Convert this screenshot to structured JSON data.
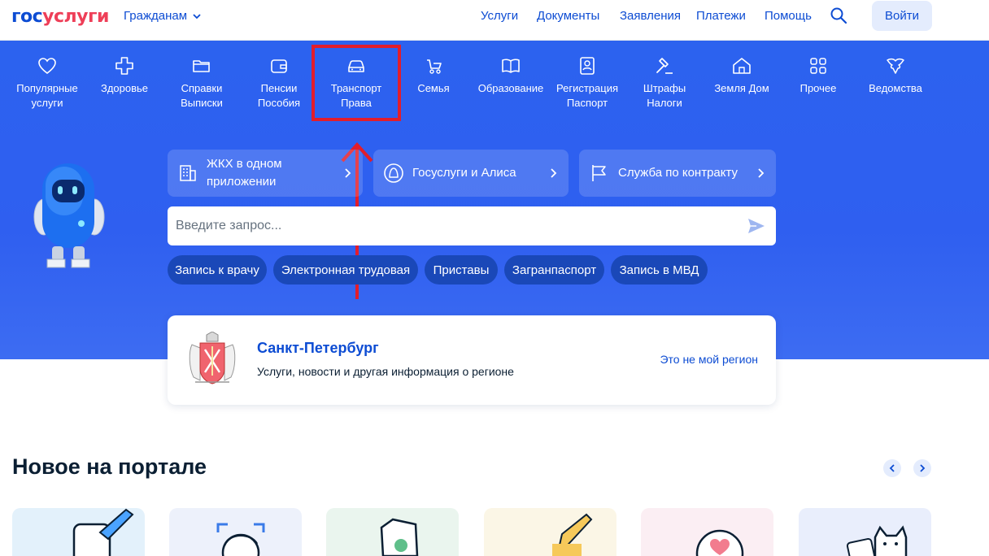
{
  "header": {
    "logo_part1": "гос",
    "logo_part2": "услуги",
    "audience_label": "Гражданам",
    "nav": [
      "Услуги",
      "Документы",
      "Заявления",
      "Платежи",
      "Помощь"
    ],
    "login_label": "Войти"
  },
  "categories": [
    {
      "label": "Популярные\nуслуги",
      "icon": "heart-icon"
    },
    {
      "label": "Здоровье",
      "icon": "medical-cross-icon"
    },
    {
      "label": "Справки\nВыписки",
      "icon": "folder-icon"
    },
    {
      "label": "Пенсии\nПособия",
      "icon": "wallet-icon"
    },
    {
      "label": "Транспорт\nПрава",
      "icon": "car-icon"
    },
    {
      "label": "Семья",
      "icon": "stroller-icon"
    },
    {
      "label": "Образование",
      "icon": "book-icon"
    },
    {
      "label": "Регистрация\nПаспорт",
      "icon": "id-card-icon"
    },
    {
      "label": "Штрафы\nНалоги",
      "icon": "gavel-icon"
    },
    {
      "label": "Земля Дом",
      "icon": "house-icon"
    },
    {
      "label": "Прочее",
      "icon": "grid-icon"
    },
    {
      "label": "Ведомства",
      "icon": "eagle-icon"
    }
  ],
  "promos": [
    {
      "text": "ЖКХ в одном\nприложении",
      "icon": "building-icon"
    },
    {
      "text": "Госуслуги и Алиса",
      "icon": "alice-icon"
    },
    {
      "text": "Служба по контракту",
      "icon": "flag-icon"
    }
  ],
  "search": {
    "placeholder": "Введите запрос..."
  },
  "chips": [
    "Запись к врачу",
    "Электронная трудовая",
    "Приставы",
    "Загранпаспорт",
    "Запись в МВД"
  ],
  "region": {
    "title": "Санкт-Петербург",
    "subtitle": "Услуги, новости и другая информация о регионе",
    "link": "Это не мой регион"
  },
  "news": {
    "title": "Новое на портале"
  },
  "colors": {
    "brand_blue": "#0d4cd3",
    "brand_red": "#ee3f58",
    "hero_blue": "#2f5ff0",
    "highlight_red": "#e21d2b"
  }
}
